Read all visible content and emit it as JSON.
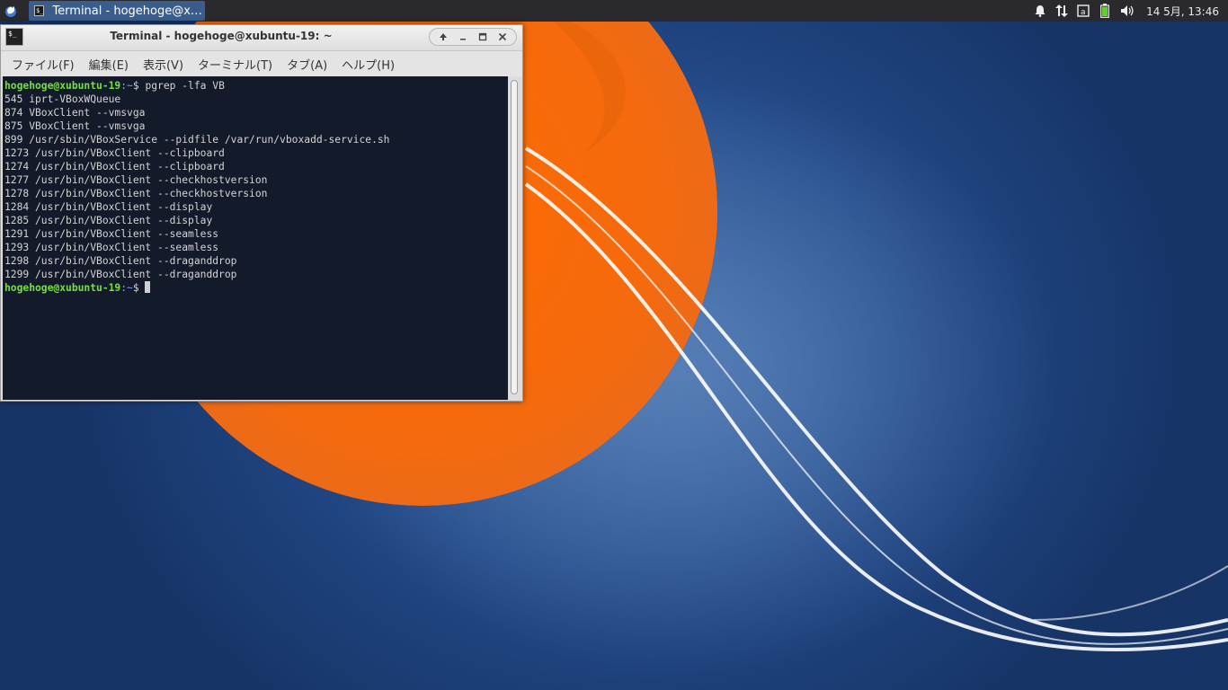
{
  "panel": {
    "task_title": "Terminal - hogehoge@x…",
    "clock": "14 5月, 13:46",
    "tray_icons": [
      "notification-icon",
      "network-icon",
      "keyboard-layout-icon",
      "battery-icon",
      "volume-icon"
    ]
  },
  "window": {
    "title": "Terminal - hogehoge@xubuntu-19: ~",
    "menu": [
      "ファイル(F)",
      "編集(E)",
      "表示(V)",
      "ターミナル(T)",
      "タブ(A)",
      "ヘルプ(H)"
    ]
  },
  "terminal": {
    "prompt_user": "hogehoge@xubuntu-19",
    "prompt_path": ":~",
    "prompt_symbol": "$ ",
    "command": "pgrep -lfa VB",
    "output": [
      "545 iprt-VBoxWQueue",
      "874 VBoxClient --vmsvga",
      "875 VBoxClient --vmsvga",
      "899 /usr/sbin/VBoxService --pidfile /var/run/vboxadd-service.sh",
      "1273 /usr/bin/VBoxClient --clipboard",
      "1274 /usr/bin/VBoxClient --clipboard",
      "1277 /usr/bin/VBoxClient --checkhostversion",
      "1278 /usr/bin/VBoxClient --checkhostversion",
      "1284 /usr/bin/VBoxClient --display",
      "1285 /usr/bin/VBoxClient --display",
      "1291 /usr/bin/VBoxClient --seamless",
      "1293 /usr/bin/VBoxClient --seamless",
      "1298 /usr/bin/VBoxClient --draganddrop",
      "1299 /usr/bin/VBoxClient --draganddrop"
    ]
  },
  "colors": {
    "panel_bg": "#2a2a2e",
    "task_active": "#3a5d8c",
    "terminal_bg": "#131a2a",
    "prompt_user": "#76e043",
    "prompt_path": "#7aa3ff",
    "wallpaper_orange": "#f26a0c"
  }
}
